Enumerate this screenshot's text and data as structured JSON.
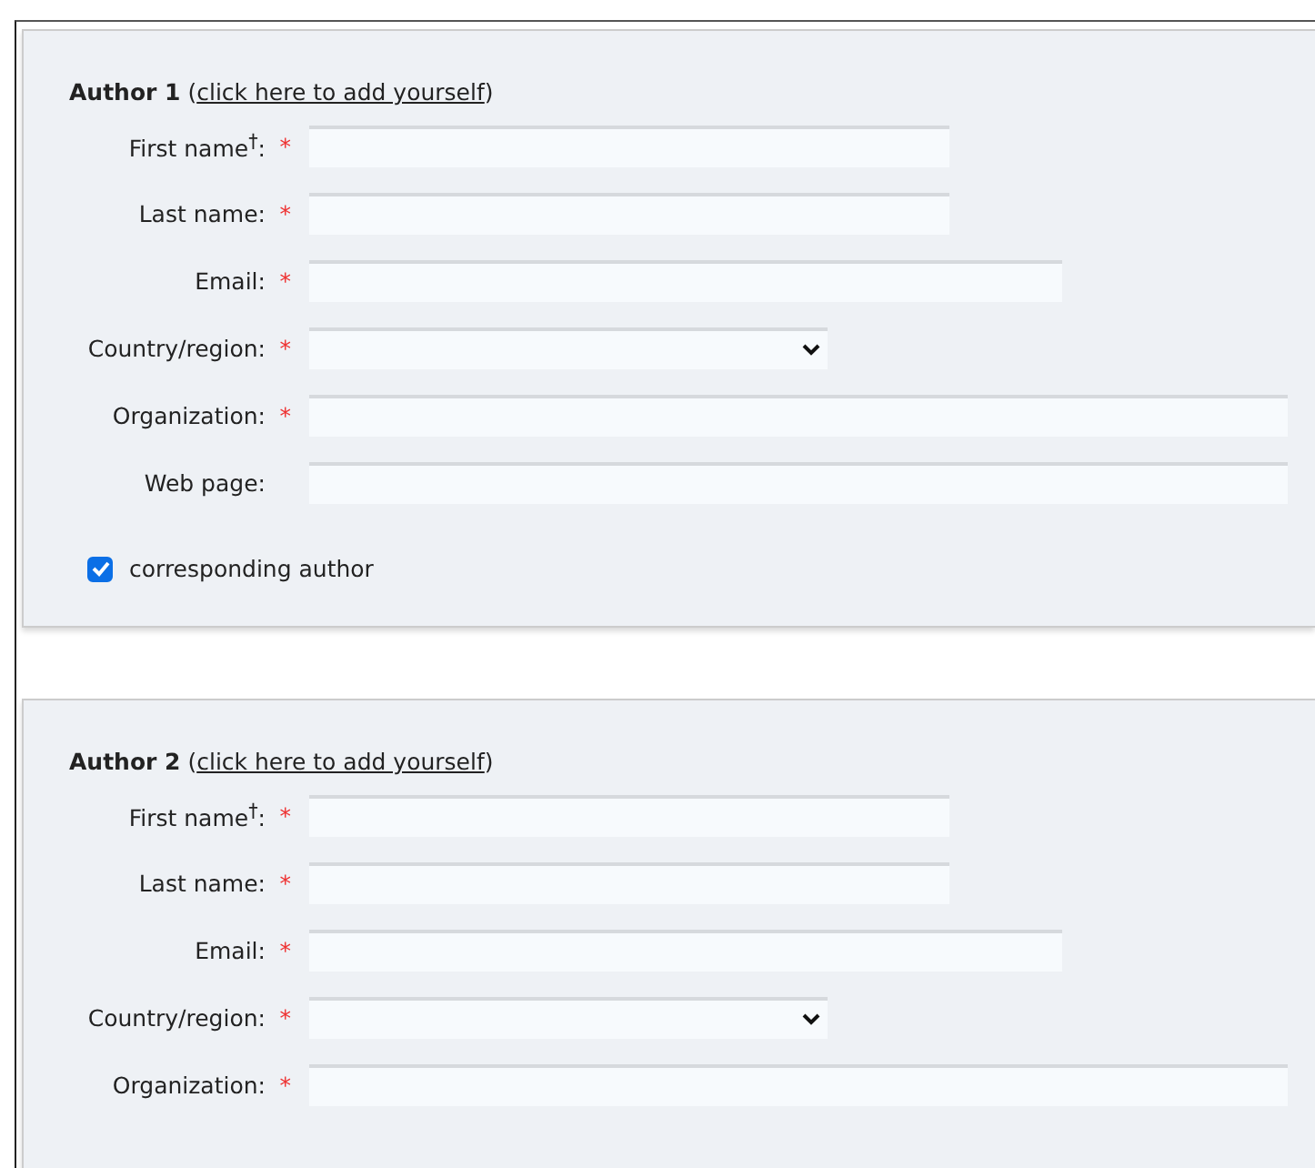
{
  "authors": [
    {
      "title": "Author 1",
      "open": "(",
      "link": "click here to add yourself",
      "close": ")",
      "fields": [
        {
          "label": "First name$^{†}$:",
          "required": true,
          "kind": "name"
        },
        {
          "label": "Last name:",
          "required": true,
          "kind": "name"
        },
        {
          "label": "Email:",
          "required": true,
          "kind": "email"
        },
        {
          "label": "Country/region:",
          "required": true,
          "kind": "select"
        },
        {
          "label": "Organization:",
          "required": true,
          "kind": "wide"
        },
        {
          "label": "Web page:",
          "required": false,
          "kind": "wide"
        }
      ],
      "corresponding": {
        "label": "corresponding author",
        "checked": true
      }
    },
    {
      "title": "Author 2",
      "open": "(",
      "link": "click here to add yourself",
      "close": ")",
      "fields": [
        {
          "label": "First name$^{†}$:",
          "required": true,
          "kind": "name"
        },
        {
          "label": "Last name:",
          "required": true,
          "kind": "name"
        },
        {
          "label": "Email:",
          "required": true,
          "kind": "email"
        },
        {
          "label": "Country/region:",
          "required": true,
          "kind": "select"
        },
        {
          "label": "Organization:",
          "required": true,
          "kind": "wide"
        }
      ]
    }
  ],
  "required_mark": "*"
}
